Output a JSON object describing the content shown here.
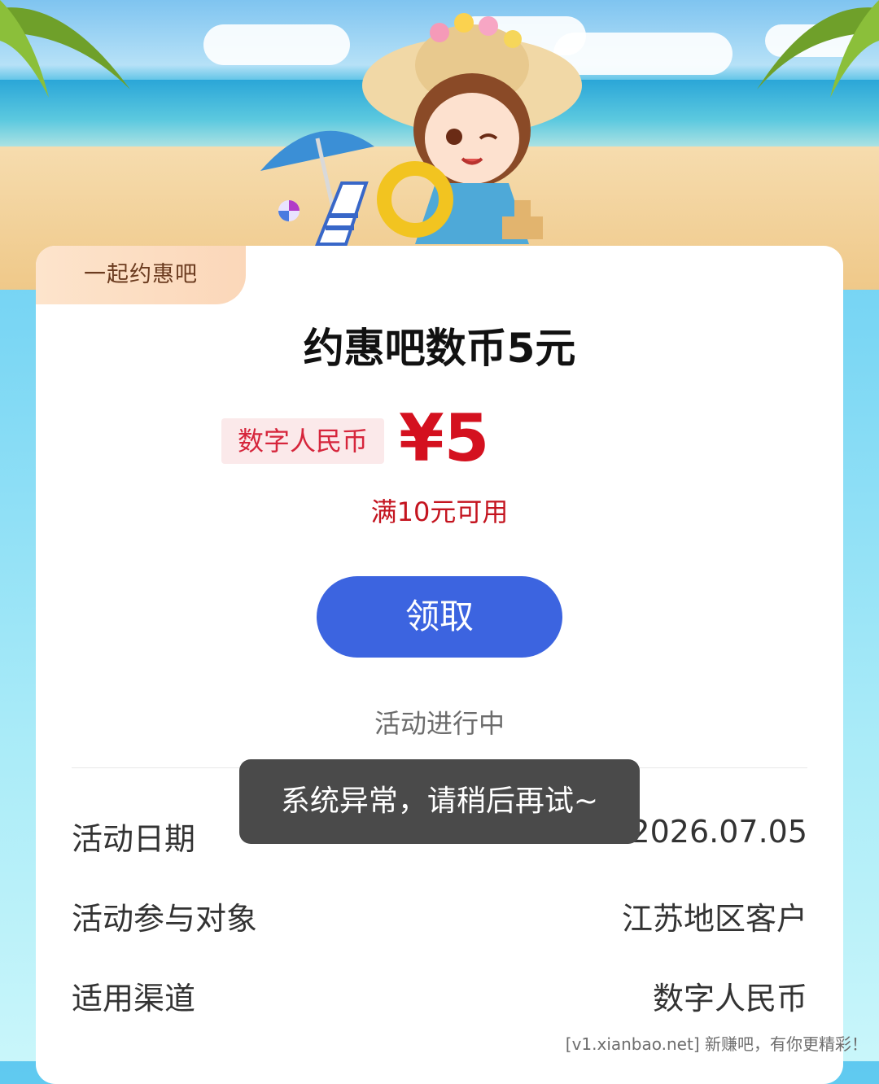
{
  "card": {
    "tag": "一起约惠吧",
    "title": "约惠吧数币5元",
    "payment_badge": "数字人民币",
    "price": "¥5",
    "min_spend": "满10元可用",
    "claim_button": "领取",
    "status": "活动进行中",
    "details": [
      {
        "label": "活动日期",
        "value": "2026.07.02-2026.07.05"
      },
      {
        "label": "活动参与对象",
        "value": "江苏地区客户"
      },
      {
        "label": "适用渠道",
        "value": "数字人民币"
      }
    ]
  },
  "toast": "系统异常，请稍后再试~",
  "watermark": "[v1.xianbao.net] 新赚吧，有你更精彩！",
  "colors": {
    "accent_blue": "#3c64e0",
    "price_red": "#d4111f",
    "tag_bg": "#fde4cc"
  }
}
